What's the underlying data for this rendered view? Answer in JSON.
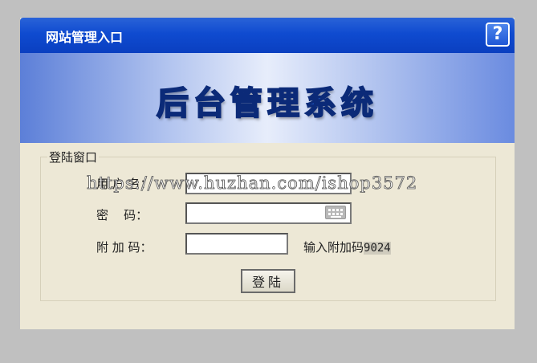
{
  "header": {
    "title": "网站管理入口",
    "help_label": "?"
  },
  "banner": {
    "title": "后台管理系统"
  },
  "login_form": {
    "legend": "登陆窗口",
    "username_label": "用 户 名：",
    "username_value": "",
    "password_label": "密    码：",
    "password_value": "",
    "captcha_label": "附 加 码：",
    "captcha_value": "",
    "captcha_hint": "输入附加码",
    "captcha_code": "9024",
    "submit_label": "登陆"
  },
  "watermark": "https://www.huzhan.com/ishop3572",
  "icons": {
    "help": "help-question-icon",
    "keyboard": "keyboard-icon"
  },
  "colors": {
    "titlebar": "#0f4bd0",
    "panel_bg": "#ede8d6",
    "page_bg": "#c0c0c0"
  }
}
